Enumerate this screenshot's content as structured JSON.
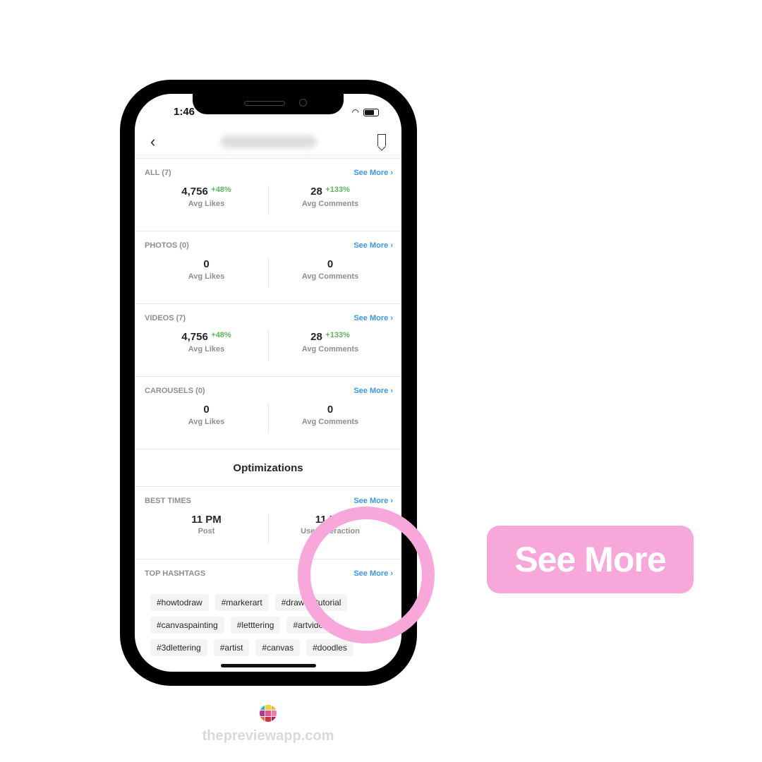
{
  "status_bar": {
    "time": "1:46"
  },
  "header": {
    "title_blurred": true
  },
  "sections": [
    {
      "label": "ALL (7)",
      "see_more": "See More",
      "left": {
        "value": "4,756",
        "change": "+48%",
        "label": "Avg Likes"
      },
      "right": {
        "value": "28",
        "change": "+133%",
        "label": "Avg Comments"
      }
    },
    {
      "label": "PHOTOS (0)",
      "see_more": "See More",
      "left": {
        "value": "0",
        "change": "",
        "label": "Avg Likes"
      },
      "right": {
        "value": "0",
        "change": "",
        "label": "Avg Comments"
      }
    },
    {
      "label": "VIDEOS (7)",
      "see_more": "See More",
      "left": {
        "value": "4,756",
        "change": "+48%",
        "label": "Avg Likes"
      },
      "right": {
        "value": "28",
        "change": "+133%",
        "label": "Avg Comments"
      }
    },
    {
      "label": "CAROUSELS (0)",
      "see_more": "See More",
      "left": {
        "value": "0",
        "change": "",
        "label": "Avg Likes"
      },
      "right": {
        "value": "0",
        "change": "",
        "label": "Avg Comments"
      }
    }
  ],
  "optimizations": {
    "title": "Optimizations"
  },
  "best_times": {
    "label": "BEST TIMES",
    "see_more": "See More",
    "left": {
      "value": "11 PM",
      "label": "Post"
    },
    "right": {
      "value": "11 PM",
      "label": "User Interaction"
    }
  },
  "top_hashtags": {
    "label": "TOP HASHTAGS",
    "see_more": "See More",
    "tags": [
      "#howtodraw",
      "#markerart",
      "#drawingtutorial",
      "#canvaspainting",
      "#letttering",
      "#artvideo",
      "#3dlettering",
      "#artist",
      "#canvas",
      "#doodles"
    ]
  },
  "callout": {
    "label": "See More",
    "color": "#f7a7da"
  },
  "footer": {
    "brand": "thepreviewapp.com",
    "logo_colors": [
      "#2bb3c0",
      "#e8d33a",
      "#f0b93a",
      "#b8338e",
      "#e8558e",
      "#f07aa0",
      "#e8703a",
      "#d9304a",
      "#c2185b"
    ]
  }
}
